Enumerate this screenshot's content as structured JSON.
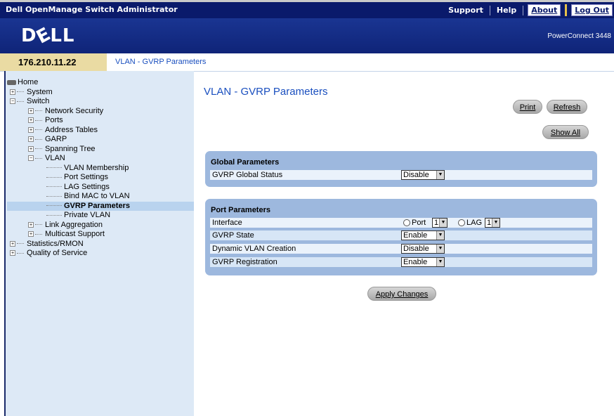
{
  "app": {
    "title": "Dell OpenManage Switch Administrator",
    "links": {
      "support": "Support",
      "help": "Help",
      "about": "About",
      "logout": "Log Out"
    },
    "logo": "D LL",
    "logo_e": "E",
    "model": "PowerConnect 3448"
  },
  "ip": "176.210.11.22",
  "breadcrumb": "VLAN - GVRP Parameters",
  "tree": {
    "home": "Home",
    "system": "System",
    "switch": "Switch",
    "network_security": "Network Security",
    "ports": "Ports",
    "address_tables": "Address Tables",
    "garp": "GARP",
    "spanning_tree": "Spanning Tree",
    "vlan": "VLAN",
    "vlan_membership": "VLAN Membership",
    "port_settings": "Port Settings",
    "lag_settings": "LAG Settings",
    "bind_mac": "Bind MAC to VLAN",
    "gvrp": "GVRP Parameters",
    "private_vlan": "Private VLAN",
    "link_aggregation": "Link Aggregation",
    "multicast": "Multicast Support",
    "stats": "Statistics/RMON",
    "qos": "Quality of Service"
  },
  "page": {
    "title": "VLAN - GVRP Parameters",
    "buttons": {
      "print": "Print",
      "refresh": "Refresh",
      "show_all": "Show All",
      "apply": "Apply Changes"
    },
    "global": {
      "header": "Global Parameters",
      "status_label": "GVRP Global Status",
      "status_value": "Disable"
    },
    "port": {
      "header": "Port Parameters",
      "interface_label": "Interface",
      "port_label": "Port",
      "port_value": "1",
      "lag_label": "LAG",
      "lag_value": "1",
      "state_label": "GVRP State",
      "state_value": "Enable",
      "dyn_label": "Dynamic VLAN Creation",
      "dyn_value": "Disable",
      "reg_label": "GVRP Registration",
      "reg_value": "Enable"
    }
  }
}
